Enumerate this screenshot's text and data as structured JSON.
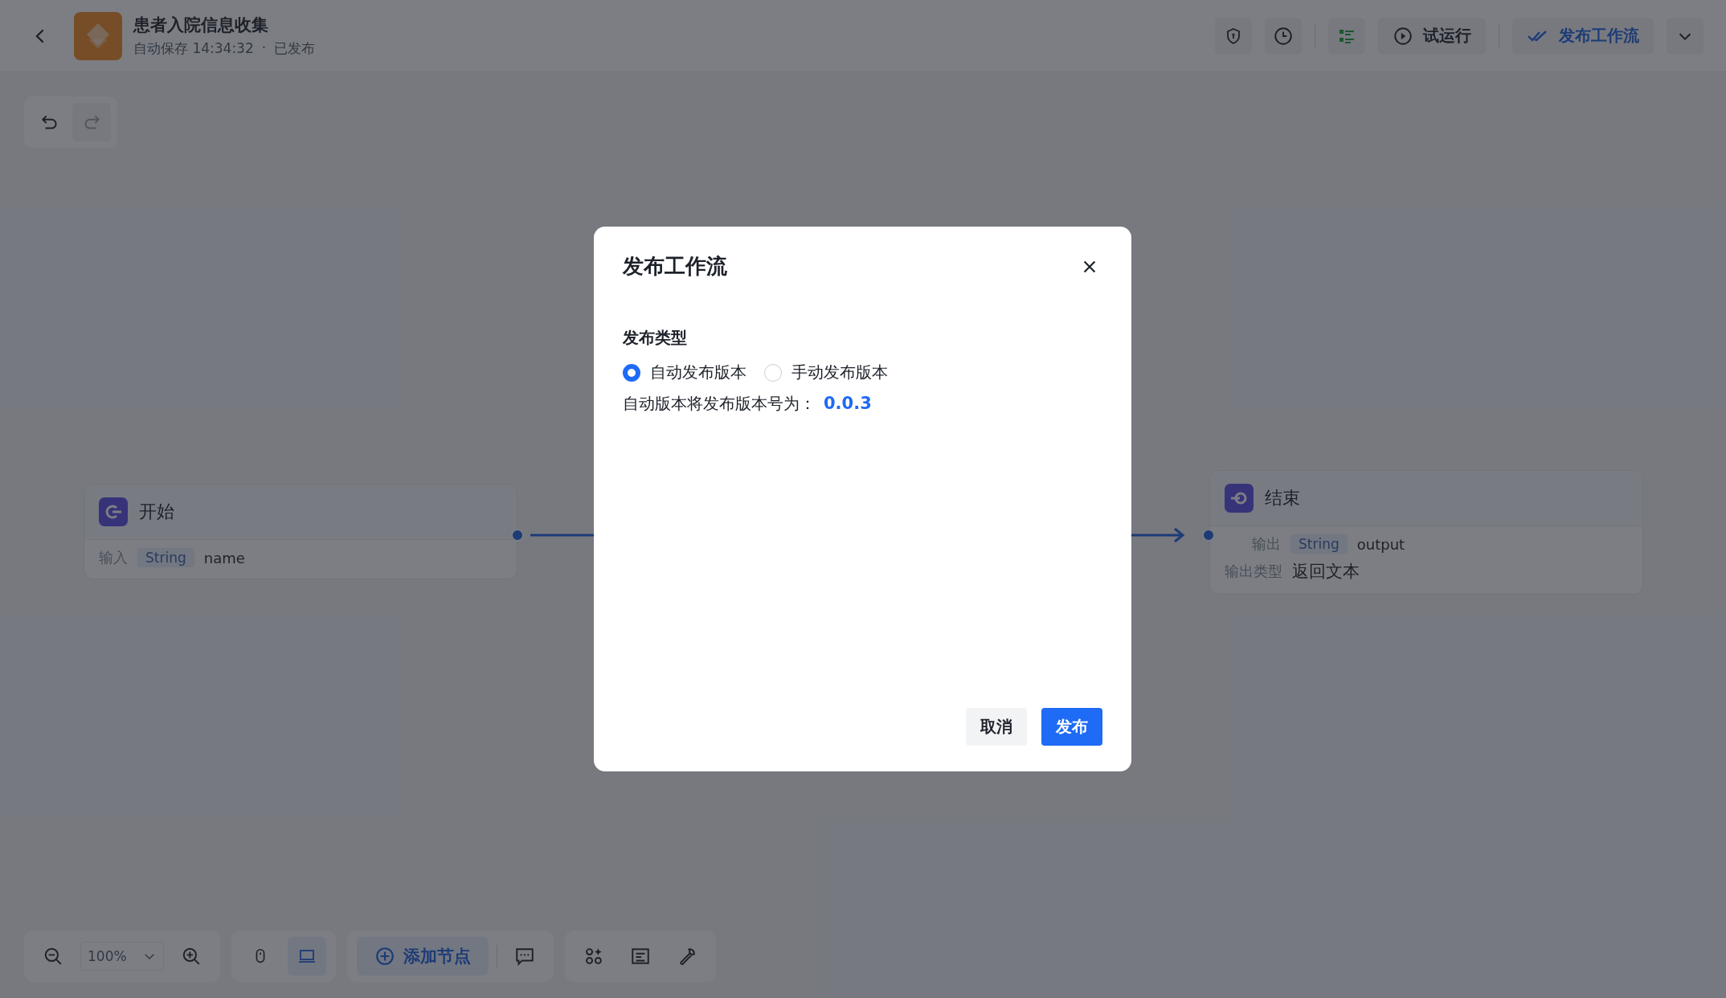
{
  "header": {
    "title": "患者入院信息收集",
    "autosave": "自动保存 14:34:32",
    "separator": "·",
    "status": "已发布",
    "test_run": "试运行",
    "publish": "发布工作流"
  },
  "nodes": [
    {
      "kind": "start",
      "title": "开始",
      "rows": [
        {
          "label": "输入",
          "type": "String",
          "name": "name"
        }
      ]
    },
    {
      "kind": "end",
      "title": "结束",
      "rows": [
        {
          "label": "输出",
          "type": "String",
          "name": "output"
        }
      ],
      "fields": [
        {
          "label": "输出类型",
          "value": "返回文本"
        }
      ]
    }
  ],
  "bottom_toolbar": {
    "zoom": "100%",
    "modes": [
      {
        "kind": "mouse",
        "selected": false
      },
      {
        "kind": "laptop",
        "selected": true
      }
    ],
    "add_node": "添加节点"
  },
  "dialog": {
    "title": "发布工作流",
    "section": "发布类型",
    "options": [
      {
        "label": "自动发布版本",
        "selected": true
      },
      {
        "label": "手动发布版本",
        "selected": false
      }
    ],
    "info": "自动版本将发布版本号为：",
    "version": "0.0.3",
    "cancel": "取消",
    "confirm": "发布"
  }
}
